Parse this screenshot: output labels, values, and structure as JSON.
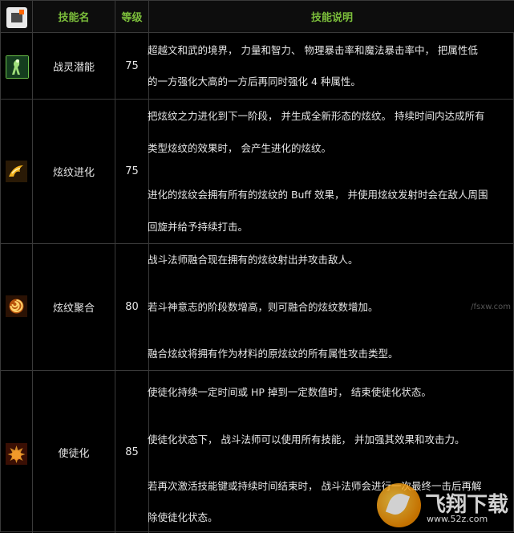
{
  "header": {
    "col_name": "技能名",
    "col_level": "等级",
    "col_desc": "技能说明"
  },
  "rows": [
    {
      "name": "战灵潜能",
      "level": "75",
      "icon": "spirit-figure-icon",
      "lines": [
        "超越文和武的境界， 力量和智力、 物理暴击率和魔法暴击率中， 把属性低",
        "的一方强化大高的一方后再同时强化 4 种属性。"
      ]
    },
    {
      "name": "炫纹进化",
      "level": "75",
      "icon": "flame-mark-icon",
      "lines": [
        "把炫纹之力进化到下一阶段， 并生成全新形态的炫纹。 持续时间内达成所有",
        "类型炫纹的效果时， 会产生进化的炫纹。",
        "进化的炫纹会拥有所有的炫纹的 Buff 效果， 并使用炫纹发射时会在敌人周围",
        "回旋并给予持续打击。"
      ]
    },
    {
      "name": "炫纹聚合",
      "level": "80",
      "icon": "spiral-fire-icon",
      "lines": [
        "战斗法师融合现在拥有的炫纹射出并攻击敌人。",
        "若斗神意志的阶段数增高，则可融合的炫纹数增加。",
        "融合炫纹将拥有作为材料的原炫纹的所有属性攻击类型。"
      ]
    },
    {
      "name": "使徒化",
      "level": "85",
      "icon": "apostle-burst-icon",
      "lines": [
        "使徒化持续一定时间或 HP 掉到一定数值时， 结束使徒化状态。",
        "使徒化状态下， 战斗法师可以使用所有技能， 并加强其效果和攻击力。",
        "若再次激活技能键或持续时间结束时， 战斗法师会进行一次最终一击后再解",
        "除使徒化状态。"
      ]
    }
  ],
  "watermark": {
    "title": "飞翔下载",
    "url": "www.52z.com",
    "faint": "/fsxw.com"
  },
  "colors": {
    "header_text": "#7cbf3b",
    "border": "#3a3a3a",
    "background": "#000000"
  }
}
